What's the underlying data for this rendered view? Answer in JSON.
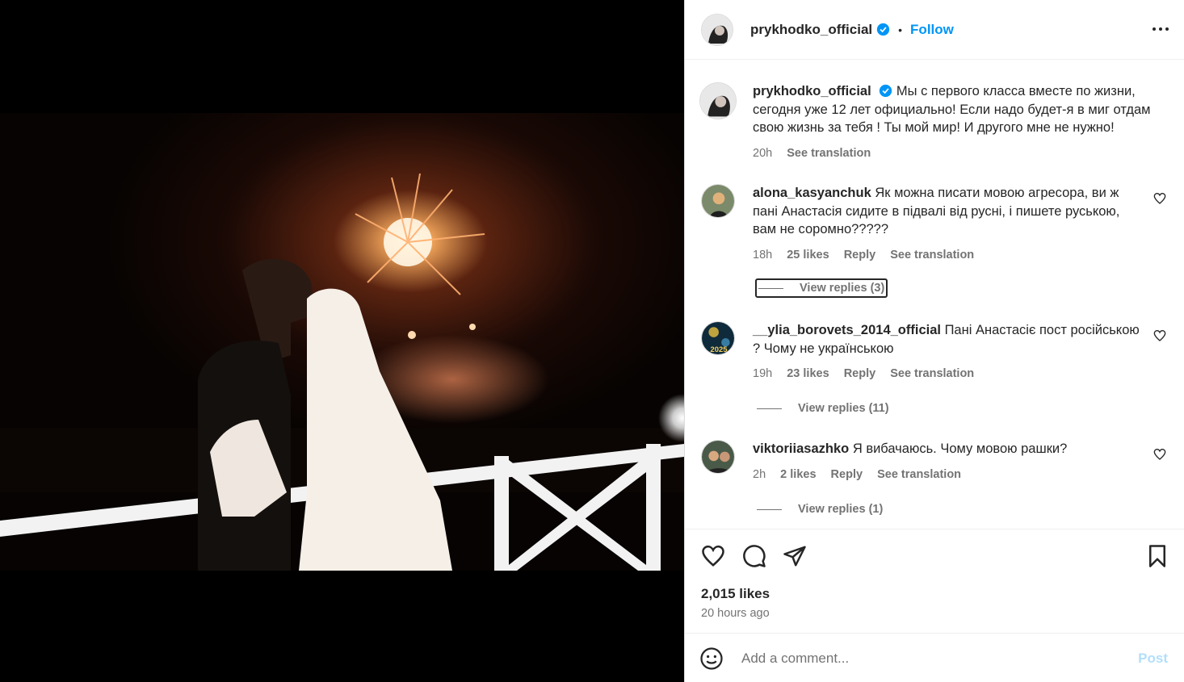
{
  "post": {
    "author": "prykhodko_official",
    "follow_label": "Follow",
    "caption": "Мы с первого класса вместе по жизни, сегодня уже 12 лет официально! Если надо будет-я в миг отдам свою жизнь за тебя ! Ты мой мир! И другого мне не нужно!",
    "caption_time": "20h",
    "see_translation": "See translation",
    "likes": "2,015 likes",
    "time_ago": "20 hours ago"
  },
  "comments": [
    {
      "user": "alona_kasyanchuk",
      "text": "Як можна писати мовою агресора, ви ж пані Анастасія сидите в підвалі від русні, і пишете руською, вам не соромно?????",
      "time": "18h",
      "likes": "25 likes",
      "reply": "Reply",
      "see_translation": "See translation",
      "view_replies": "View replies (3)"
    },
    {
      "user": "__ylia_borovets_2014_official",
      "text": "Пані Анастасіє пост російською ? Чому не українською",
      "time": "19h",
      "likes": "23 likes",
      "reply": "Reply",
      "see_translation": "See translation",
      "view_replies": "View replies (11)",
      "avatar_text": "2025"
    },
    {
      "user": "viktoriiasazhko",
      "text": "Я вибачаюсь. Чому мовою рашки?",
      "time": "2h",
      "likes": "2 likes",
      "reply": "Reply",
      "see_translation": "See translation",
      "view_replies": "View replies (1)"
    }
  ],
  "add_comment": {
    "placeholder": "Add a comment...",
    "post_label": "Post"
  },
  "colors": {
    "accent": "#0095f6",
    "muted": "#737373",
    "text": "#262626",
    "post_disabled": "#b2dffc"
  },
  "icons": [
    "verified-badge-icon",
    "more-options-icon",
    "heart-icon",
    "comment-icon",
    "share-icon",
    "bookmark-icon",
    "emoji-icon"
  ]
}
